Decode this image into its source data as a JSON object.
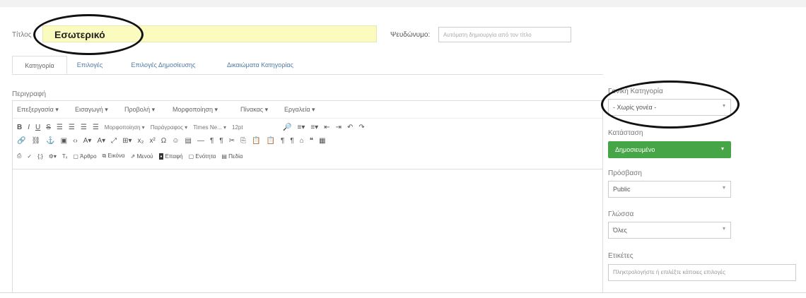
{
  "title_field": {
    "label": "Τίτλος",
    "value": "Εσωτερικό"
  },
  "alias_field": {
    "label": "Ψευδώνυμο:",
    "placeholder": "Αυτόματη δημιουργία από τον τίτλο"
  },
  "tabs": [
    {
      "label": "Κατηγορία",
      "active": true
    },
    {
      "label": "Επιλογές",
      "active": false
    },
    {
      "label": "Επιλογές Δημοσίευσης",
      "active": false
    },
    {
      "label": "Δικαιώματα Κατηγορίας",
      "active": false
    }
  ],
  "editor": {
    "label": "Περιγραφή",
    "menus": [
      "Επεξεργασία ▾",
      "Εισαγωγή ▾",
      "Προβολή ▾",
      "Μορφοποίηση ▾",
      "Πίνακας ▾",
      "Εργαλεία ▾"
    ],
    "toolbar": {
      "format_select": "Μορφοποίηση ▾",
      "paragraph_select": "Παράγραφος ▾",
      "font_select": "Times Ne... ▾",
      "size_select": "12pt",
      "buttons": {
        "article": "Άρθρο",
        "image": "Εικόνα",
        "menu": "Μενού",
        "contact": "Επαφή",
        "module": "Ενότητα",
        "fields": "Πεδία"
      }
    }
  },
  "sidebar": {
    "parent": {
      "label": "Γονική Κατηγορία",
      "value": "- Χωρίς γονέα -"
    },
    "status": {
      "label": "Κατάσταση",
      "value": "Δημοσιευμένο",
      "color": "#46a546"
    },
    "access": {
      "label": "Πρόσβαση",
      "value": "Public"
    },
    "language": {
      "label": "Γλώσσα",
      "value": "Όλες"
    },
    "tags": {
      "label": "Ετικέτες",
      "placeholder": "Πληκτρολογήστε ή επιλέξτε κάποιες επιλογές"
    }
  },
  "annotations": {
    "ellipse_color": "#111111"
  }
}
